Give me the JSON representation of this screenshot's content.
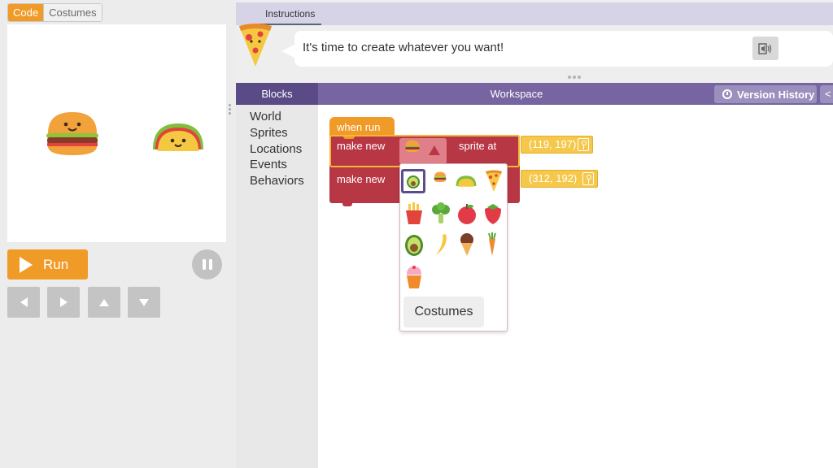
{
  "mode_toggle": {
    "code": "Code",
    "costumes": "Costumes"
  },
  "controls": {
    "run_label": "Run"
  },
  "instructions": {
    "tab_label": "Instructions",
    "message": "It's time to create whatever you want!"
  },
  "workspace": {
    "blocks_label": "Blocks",
    "title": "Workspace",
    "version_history": "Version History",
    "extra_label": "<"
  },
  "toolbox": {
    "categories": [
      "World",
      "Sprites",
      "Locations",
      "Events",
      "Behaviors"
    ]
  },
  "blocks": {
    "when_run": "when run",
    "make_new_1": "make new",
    "sprite_at": "sprite at",
    "location_1": "(119, 197)",
    "make_new_2": "make new",
    "location_2": "(312, 192)"
  },
  "costume_options": [
    "avocado",
    "burger",
    "taco",
    "pizza",
    "fries",
    "broccoli",
    "apple",
    "strawberry",
    "avocado-half",
    "banana",
    "ice-cream",
    "carrot",
    "cupcake"
  ],
  "dropdown": {
    "costumes_button": "Costumes"
  },
  "colors": {
    "accent_orange": "#f09b28",
    "header_purple": "#7665a0",
    "block_red": "#b83744",
    "location_yellow": "#f5c84b"
  }
}
